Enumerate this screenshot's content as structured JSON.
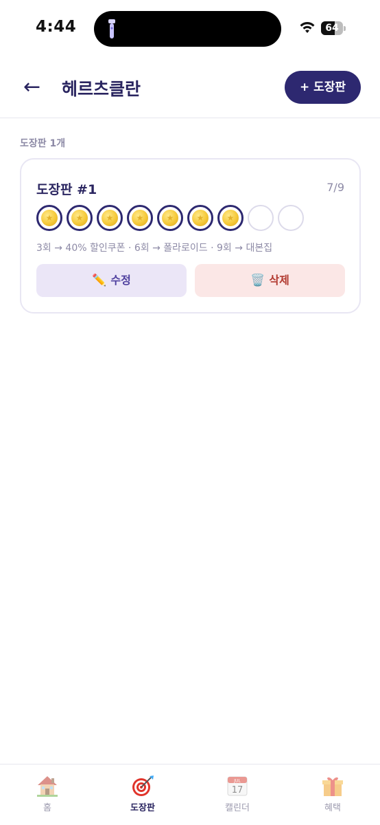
{
  "status_bar": {
    "time": "4:44",
    "battery": "64",
    "battery_level": 0.64
  },
  "header": {
    "back_icon": "←",
    "title": "헤르츠클란",
    "add_button_label": "+ 도장판"
  },
  "summary": {
    "count_label": "도장판 1개"
  },
  "board": {
    "title": "도장판 #1",
    "progress": "7/9",
    "stamps_filled": 7,
    "stamps_total": 9,
    "rewards": "3회 → 40% 할인쿠폰 · 6회 → 폴라로이드 · 9회 → 대본집",
    "edit_label": "수정",
    "delete_label": "삭제"
  },
  "tabs": [
    {
      "label": "홈",
      "icon": "house-icon",
      "active": false
    },
    {
      "label": "도장판",
      "icon": "dart-target-icon",
      "active": true
    },
    {
      "label": "캘린더",
      "icon": "calendar-icon",
      "active": false
    },
    {
      "label": "혜택",
      "icon": "gift-icon",
      "active": false
    }
  ],
  "calendar_icon_day": "17",
  "calendar_icon_month": "JUL"
}
